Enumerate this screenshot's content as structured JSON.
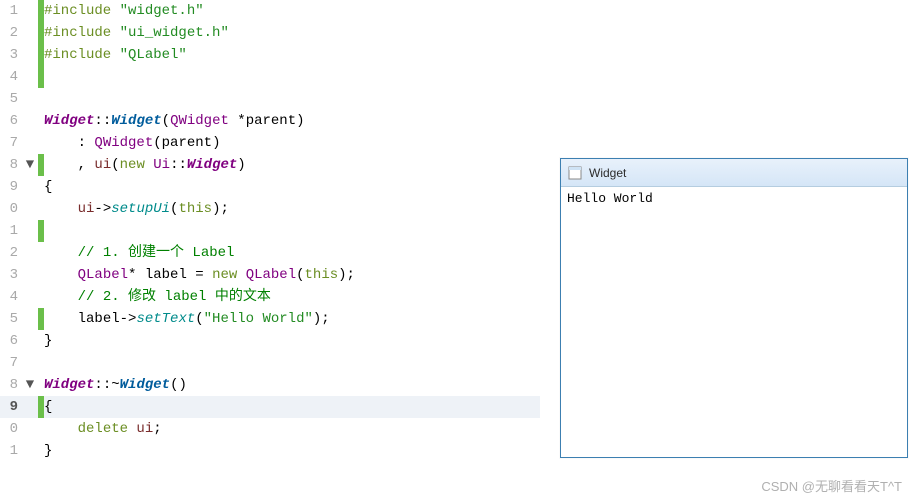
{
  "gutter": {
    "lines": [
      "1",
      "2",
      "3",
      "4",
      "5",
      "6",
      "7",
      "8",
      "9",
      "0",
      "1",
      "2",
      "3",
      "4",
      "5",
      "6",
      "7",
      "8",
      "9",
      "0",
      "1"
    ],
    "folds": {
      "8": "▼",
      "18": "▼"
    },
    "marks": {
      "1": true,
      "2": true,
      "3": true,
      "4": true,
      "8": true,
      "11": true,
      "15": true,
      "19": true
    }
  },
  "code": {
    "l1": {
      "inc": "#include ",
      "str": "\"widget.h\""
    },
    "l2": {
      "inc": "#include ",
      "str": "\"ui_widget.h\""
    },
    "l3": {
      "inc": "#include ",
      "str": "\"QLabel\""
    },
    "l4": "",
    "l5": "",
    "l6": {
      "cls": "Widget",
      "col": "::",
      "ctor": "Widget",
      "op": "(",
      "typ": "QWidget ",
      "star": "*",
      "p": "parent",
      "cp": ")"
    },
    "l7": {
      "pre": "    : ",
      "typ": "QWidget",
      "op": "(",
      "p": "parent",
      "cp": ")"
    },
    "l8": {
      "pre": "    , ",
      "id": "ui",
      "op": "(",
      "kw": "new ",
      "ns": "Ui",
      "col": "::",
      "cls": "Widget",
      "cp": ")"
    },
    "l9": "{",
    "l10": {
      "pre": "    ",
      "id": "ui",
      "ar": "->",
      "fn": "setupUi",
      "op": "(",
      "kw": "this",
      "cp": ");"
    },
    "l11": "",
    "l12": {
      "pre": "    ",
      "cm": "// 1. 创建一个 Label"
    },
    "l13": {
      "pre": "    ",
      "typ": "QLabel",
      "star": "* ",
      "id": "label ",
      "eq": "= ",
      "kw": "new ",
      "typ2": "QLabel",
      "op": "(",
      "kw2": "this",
      "cp": ");"
    },
    "l14": {
      "pre": "    ",
      "cm": "// 2. 修改 label 中的文本"
    },
    "l15": {
      "pre": "    ",
      "id": "label",
      "ar": "->",
      "fn": "setText",
      "op": "(",
      "str": "\"Hello World\"",
      "cp": ");"
    },
    "l16": "}",
    "l17": "",
    "l18": {
      "cls": "Widget",
      "col": "::~",
      "dtor": "Widget",
      "op": "()"
    },
    "l19": "{",
    "l20": {
      "pre": "    ",
      "kw": "delete ",
      "id": "ui",
      ";": ";"
    },
    "l21": "}"
  },
  "window": {
    "title": "Widget",
    "body": "Hello World"
  },
  "watermark": "CSDN @无聊看看天T^T"
}
